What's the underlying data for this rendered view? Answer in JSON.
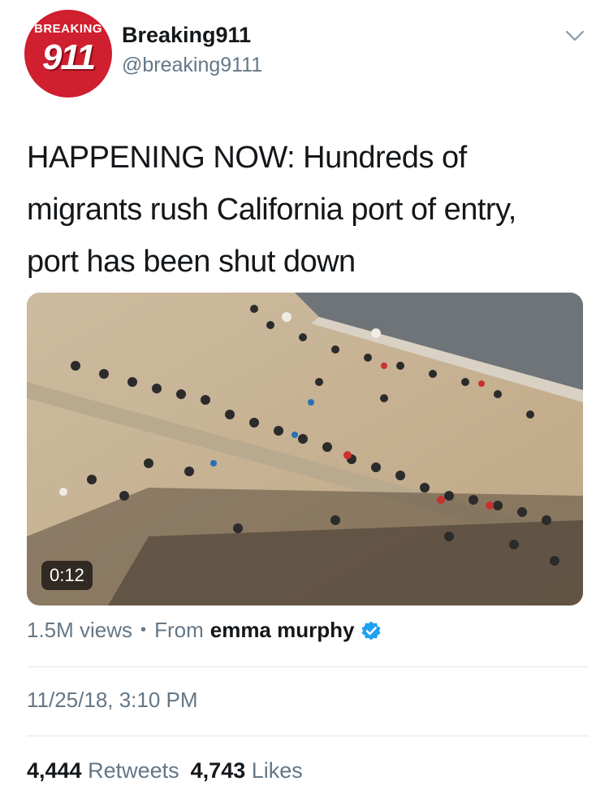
{
  "user": {
    "avatar_top_text": "BREAKING",
    "avatar_number": "911",
    "display_name": "Breaking911",
    "handle": "@breaking9111"
  },
  "tweet": {
    "lines": [
      "HAPPENING NOW: Hundreds of",
      "migrants rush California port of entry,",
      "port has been shut down"
    ]
  },
  "video": {
    "duration": "0:12"
  },
  "meta": {
    "views": "1.5M views",
    "separator": "•",
    "from_label": "From",
    "author": "emma murphy",
    "verified_icon": "verified-badge-icon"
  },
  "timestamp": "11/25/18, 3:10 PM",
  "stats": {
    "retweets_count": "4,444",
    "retweets_label": "Retweets",
    "likes_count": "4,743",
    "likes_label": "Likes"
  },
  "colors": {
    "brand_red": "#d01f2f",
    "twitter_blue": "#1da1f2",
    "secondary_text": "#657786"
  }
}
